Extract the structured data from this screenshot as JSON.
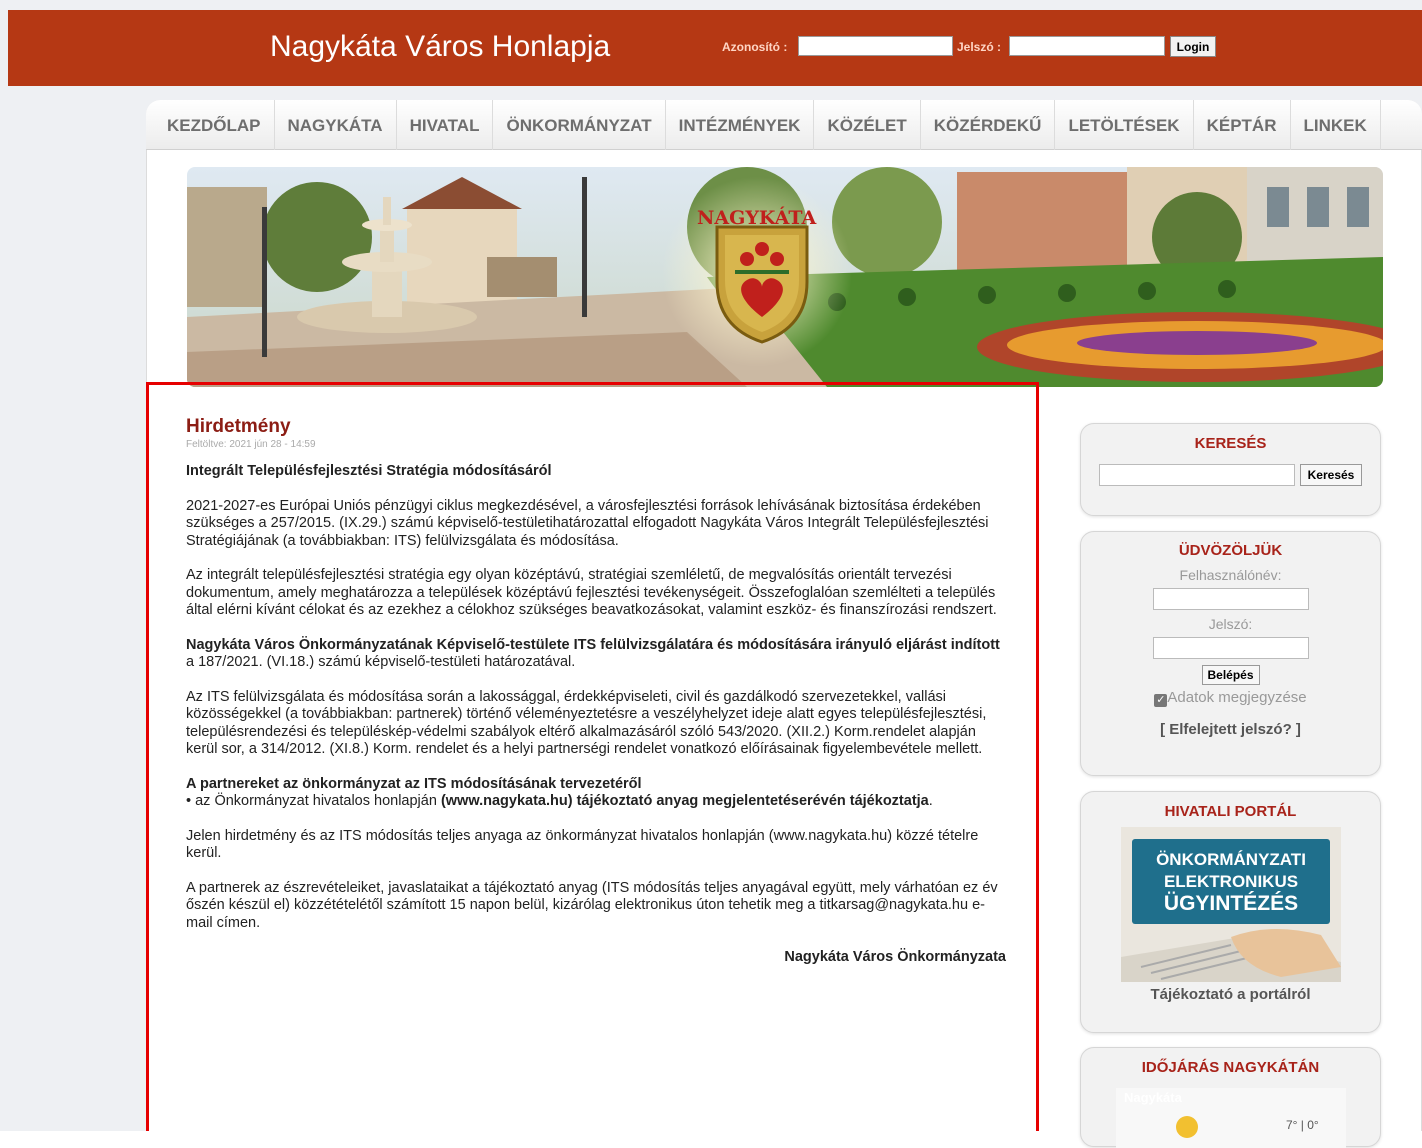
{
  "header": {
    "title": "Nagykáta Város Honlapja",
    "id_label": "Azonosító :",
    "password_label": "Jelszó :",
    "login_label": "Login"
  },
  "nav": {
    "items": [
      "KEZDŐLAP",
      "NAGYKÁTA",
      "HIVATAL",
      "ÖNKORMÁNYZAT",
      "INTÉZMÉNYEK",
      "KÖZÉLET",
      "KÖZÉRDEKŰ",
      "LETÖLTÉSEK",
      "KÉPTÁR",
      "LINKEK"
    ]
  },
  "banner": {
    "crest_text": "NAGYKÁTA"
  },
  "article": {
    "title": "Hirdetmény",
    "posted": "Feltöltve: 2021 jún 28 - 14:59",
    "subtitle": "Integrált Településfejlesztési Stratégia módosításáról",
    "p1": "2021-2027-es Európai Uniós pénzügyi ciklus megkezdésével, a városfejlesztési források lehívásának biztosítása érdekében szükséges a 257/2015. (IX.29.) számú képviselő-testületihatározattal elfogadott Nagykáta Város Integrált Településfejlesztési Stratégiájának (a továbbiakban: ITS) felülvizsgálata és módosítása.",
    "p2": "Az integrált településfejlesztési stratégia egy olyan középtávú, stratégiai szemléletű, de megvalósítás orientált tervezési dokumentum, amely meghatározza a települések középtávú fejlesztési tevékenységeit. Összefoglalóan szemlélteti a település által elérni kívánt célokat és az ezekhez a célokhoz szükséges beavatkozásokat, valamint eszköz- és finanszírozási rendszert.",
    "p3_bold": "Nagykáta Város Önkormányzatának Képviselő-testülete ITS felülvizsgálatára és módosítására irányuló eljárást indított",
    "p3_rest": " a 187/2021. (VI.18.) számú képviselő-testületi határozatával.",
    "p4": "Az ITS felülvizsgálata és módosítása során a lakossággal, érdekképviseleti, civil és gazdálkodó szervezetekkel, vallási közösségekkel (a továbbiakban: partnerek) történő véleményeztetésre a veszélyhelyzet ideje alatt egyes településfejlesztési, településrendezési és településkép-védelmi szabályok eltérő alkalmazásáról szóló 543/2020. (XII.2.) Korm.rendelet alapján kerül sor, a 314/2012. (XI.8.) Korm. rendelet és a helyi partnerségi rendelet vonatkozó előírásainak figyelembevétele mellett.",
    "p5_bold": "A partnereket az önkormányzat az ITS módosításának tervezetéről",
    "p5_line_a": "• az Önkormányzat hivatalos honlapján ",
    "p5_line_b": "(www.nagykata.hu) tájékoztató anyag megjelentetéserévén tájékoztatja",
    "p5_line_c": ".",
    "p6": "Jelen hirdetmény és az ITS módosítás teljes anyaga az önkormányzat hivatalos honlapján (www.nagykata.hu) közzé tételre kerül.",
    "p7": "A partnerek az észrevételeiket, javaslataikat a tájékoztató anyag (ITS módosítás teljes anyagával együtt, mely várhatóan ez év őszén készül el) közzétételétől számított 15 napon belül, kizárólag elektronikus úton tehetik meg a titkarsag@nagykata.hu e-mail címen.",
    "signature": "Nagykáta Város Önkormányzata"
  },
  "sidebar": {
    "search": {
      "title": "KERESÉS",
      "button": "Keresés"
    },
    "welcome": {
      "title": "ÜDVÖZÖLJÜK",
      "username_label": "Felhasználónév:",
      "password_label": "Jelszó:",
      "login_button": "Belépés",
      "remember_label": "Adatok megjegyzése",
      "forgot": "[ Elfelejtett jelszó? ]"
    },
    "portal": {
      "title": "HIVATALI PORTÁL",
      "banner_line1": "ÖNKORMÁNYZATI",
      "banner_line2": "ELEKTRONIKUS",
      "banner_line3": "ÜGYINTÉZÉS",
      "caption": "Tájékoztató a portálról"
    },
    "weather": {
      "title": "IDŐJÁRÁS NAGYKÁTÁN",
      "place": "Nagykáta",
      "temp": "7° | 0°"
    }
  }
}
